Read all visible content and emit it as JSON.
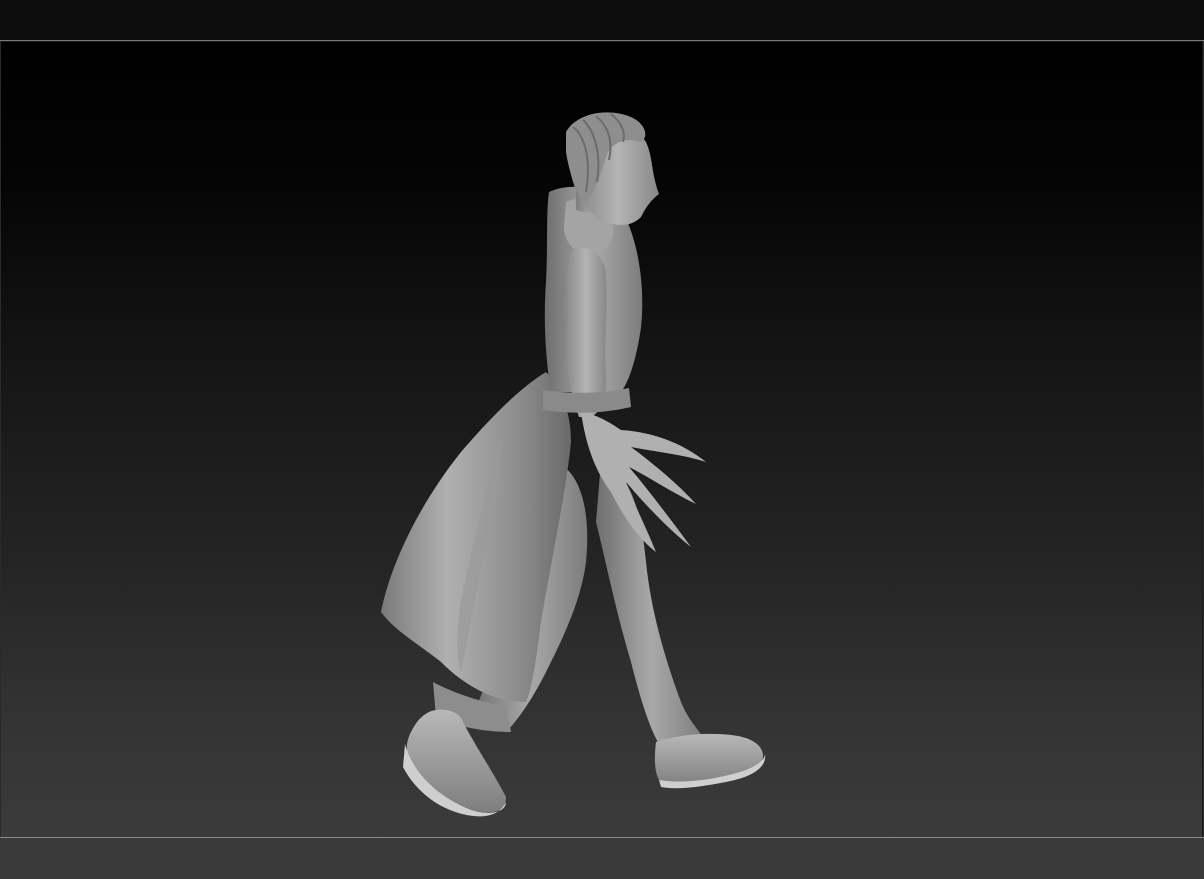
{
  "app": {
    "name": "",
    "model": {
      "icon": "sculpt-figure-icon",
      "material_color": "#9a9a9a"
    }
  },
  "colors": {
    "top_bar": "#0d0d0d",
    "bottom_bar": "#3a3a3a",
    "viewport_top": "#000000",
    "viewport_bottom": "#3b3b3b",
    "divider": "#7a7a7a"
  }
}
